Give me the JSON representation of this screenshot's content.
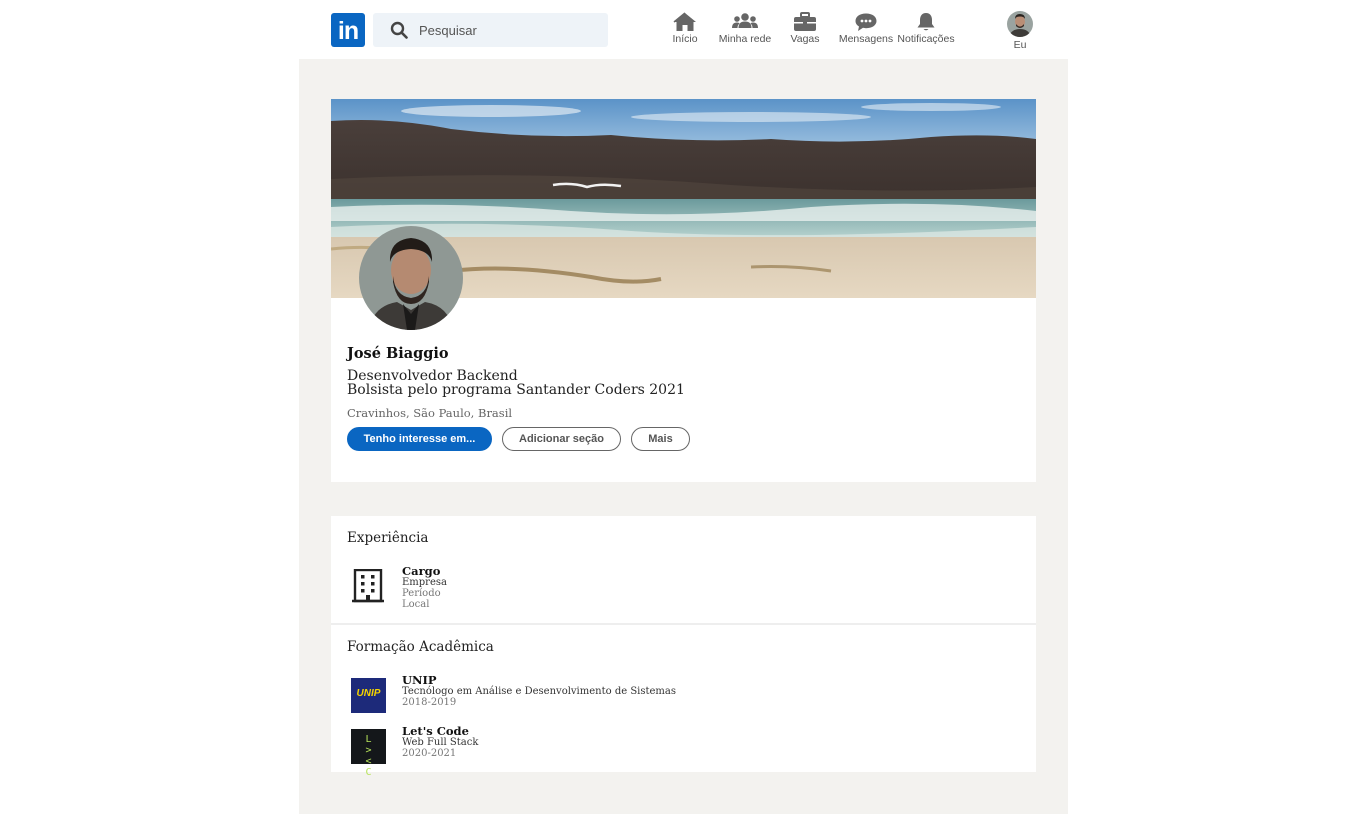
{
  "nav": {
    "logo_text": "in",
    "search_placeholder": "Pesquisar",
    "items": [
      {
        "label": "Início",
        "icon": "home-icon"
      },
      {
        "label": "Minha rede",
        "icon": "network-icon"
      },
      {
        "label": "Vagas",
        "icon": "briefcase-icon"
      },
      {
        "label": "Mensagens",
        "icon": "messages-icon"
      },
      {
        "label": "Notificações",
        "icon": "bell-icon"
      }
    ],
    "me_label": "Eu"
  },
  "profile": {
    "name": "José Biaggio",
    "headline_line1": "Desenvolvedor Backend",
    "headline_line2": "Bolsista pelo programa Santander Coders 2021",
    "location": "Cravinhos, São Paulo, Brasil",
    "buttons": {
      "primary": "Tenho interesse em...",
      "add_section": "Adicionar seção",
      "more": "Mais"
    }
  },
  "experience": {
    "title": "Experiência",
    "items": [
      {
        "role": "Cargo",
        "company": "Empresa",
        "period": "Período",
        "location": "Local",
        "icon": "building-icon"
      }
    ]
  },
  "education": {
    "title": "Formação Acadêmica",
    "items": [
      {
        "school": "UNIP",
        "course": "Tecnólogo em Análise e Desenvolvimento de Sistemas",
        "period": "2018-2019",
        "logo_text": "UNIP"
      },
      {
        "school": "Let's Code",
        "course": "Web Full Stack",
        "period": "2020-2021",
        "logo_text": "L > < C"
      }
    ]
  },
  "colors": {
    "brand": "#0a66c2",
    "page_bg": "#f3f2ef",
    "search_bg": "#eef3f8"
  }
}
